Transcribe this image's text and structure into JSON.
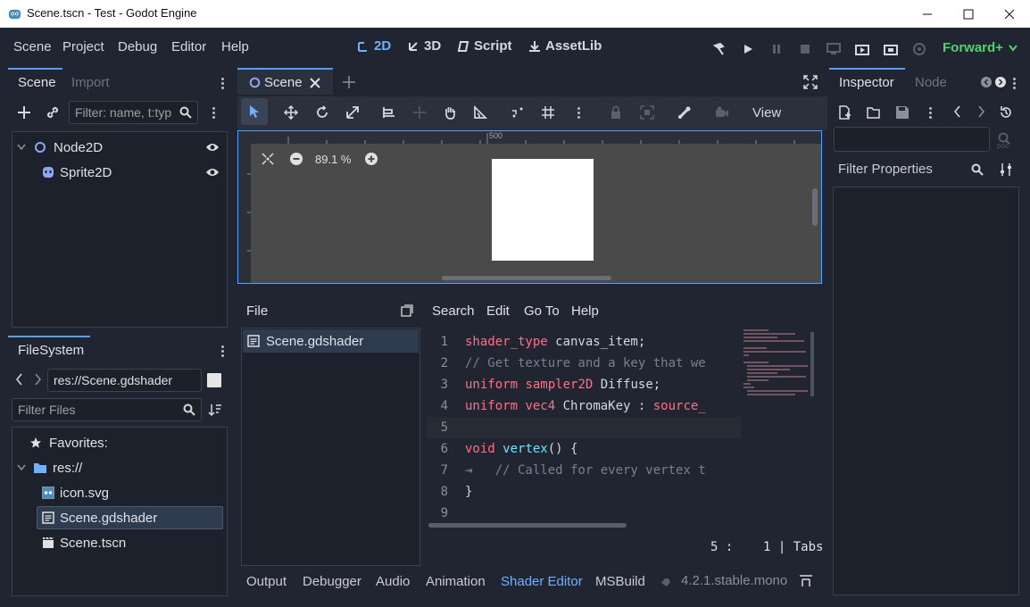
{
  "window": {
    "title": "Scene.tscn - Test - Godot Engine",
    "controls": [
      "minimize-icon",
      "maximize-icon",
      "close-icon"
    ]
  },
  "menubar": {
    "menus": [
      "Scene",
      "Project",
      "Debug",
      "Editor",
      "Help"
    ],
    "workspaces": [
      {
        "label": "2D",
        "icon": "2d-icon",
        "active": true
      },
      {
        "label": "3D",
        "icon": "3d-icon",
        "active": false
      },
      {
        "label": "Script",
        "icon": "script-icon",
        "active": false
      },
      {
        "label": "AssetLib",
        "icon": "assetlib-icon",
        "active": false
      }
    ],
    "renderer": "Forward+",
    "accent": "#6fb1ff",
    "renderer_color": "#4fd36b"
  },
  "scene_dock": {
    "tabs": [
      "Scene",
      "Import"
    ],
    "filter_placeholder": "Filter: name, t:typ",
    "nodes": [
      {
        "name": "Node2D",
        "icon": "node2d-icon"
      },
      {
        "name": "Sprite2D",
        "icon": "sprite2d-icon"
      }
    ]
  },
  "filesystem_dock": {
    "title": "FileSystem",
    "path": "res://Scene.gdshader",
    "filter_placeholder": "Filter Files",
    "favorites_label": "Favorites:",
    "root_label": "res://",
    "files": [
      {
        "name": "icon.svg",
        "icon": "godot-icon",
        "selected": false
      },
      {
        "name": "Scene.gdshader",
        "icon": "shader-icon",
        "selected": true
      },
      {
        "name": "Scene.tscn",
        "icon": "scene-file-icon",
        "selected": false
      }
    ]
  },
  "viewport": {
    "tab_label": "Scene",
    "view_label": "View",
    "zoom": "89.1 %",
    "ruler_mark": "500"
  },
  "shader_editor": {
    "file_label": "File",
    "menus": [
      "Search",
      "Edit",
      "Go To",
      "Help"
    ],
    "files": [
      "Scene.gdshader"
    ],
    "lines": [
      {
        "n": "1",
        "parts": [
          [
            "kw",
            "shader_type"
          ],
          [
            "tx",
            " canvas_item;"
          ]
        ]
      },
      {
        "n": "2",
        "parts": [
          [
            "cm",
            "// Get texture and a key that we"
          ]
        ]
      },
      {
        "n": "3",
        "parts": [
          [
            "kw",
            "uniform"
          ],
          [
            "tx",
            " "
          ],
          [
            "ty",
            "sampler2D"
          ],
          [
            "tx",
            " Diffuse;"
          ]
        ]
      },
      {
        "n": "4",
        "parts": [
          [
            "kw",
            "uniform"
          ],
          [
            "tx",
            " "
          ],
          [
            "ty",
            "vec4"
          ],
          [
            "tx",
            " ChromaKey : "
          ],
          [
            "kw",
            "source_"
          ]
        ]
      },
      {
        "n": "5",
        "parts": []
      },
      {
        "n": "6",
        "parts": [
          [
            "kw",
            "void"
          ],
          [
            "tx",
            " "
          ],
          [
            "fn",
            "vertex"
          ],
          [
            "tx",
            "() {"
          ]
        ]
      },
      {
        "n": "7",
        "parts": [
          [
            "cm",
            "⇥   // Called for every vertex t"
          ]
        ]
      },
      {
        "n": "8",
        "parts": [
          [
            "tx",
            "}"
          ]
        ]
      },
      {
        "n": "9",
        "parts": []
      }
    ],
    "cursor_status": "5 :    1 | Tabs"
  },
  "bottom_panel": {
    "tabs": [
      "Output",
      "Debugger",
      "Audio",
      "Animation",
      "Shader Editor",
      "MSBuild"
    ],
    "active_tab": "Shader Editor",
    "version": "4.2.1.stable.mono"
  },
  "inspector": {
    "tabs": [
      "Inspector",
      "Node"
    ],
    "filter_placeholder": "Filter Properties"
  }
}
